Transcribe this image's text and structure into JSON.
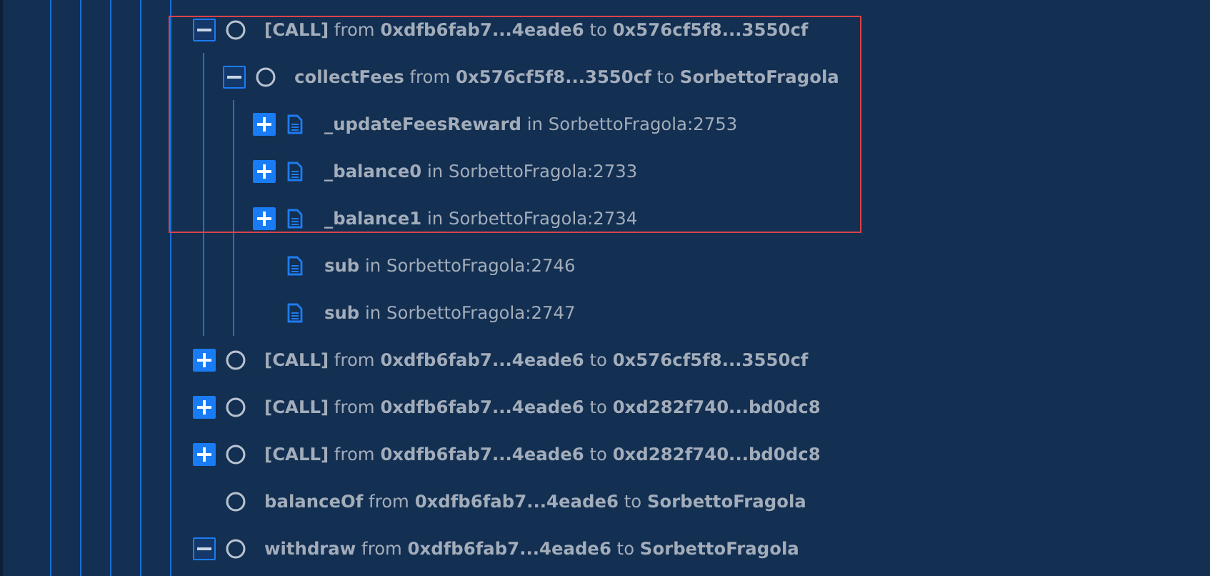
{
  "trace": [
    {
      "kind": "call",
      "expanded": true,
      "text": "**[CALL]** from **0xdfb6fab7...4eade6** to **0x576cf5f8...3550cf**",
      "children": [
        {
          "kind": "call",
          "expanded": true,
          "text": "**collectFees** from **0x576cf5f8...3550cf** to **SorbettoFragola**",
          "children": [
            {
              "kind": "function",
              "expanded": false,
              "text": "**_updateFeesReward** in SorbettoFragola:2753"
            },
            {
              "kind": "function",
              "expanded": false,
              "text": "**_balance0** in SorbettoFragola:2733"
            },
            {
              "kind": "function",
              "expanded": false,
              "text": "**_balance1** in SorbettoFragola:2734"
            },
            {
              "kind": "function",
              "text": "**sub** in SorbettoFragola:2746"
            },
            {
              "kind": "function",
              "text": "**sub** in SorbettoFragola:2747"
            }
          ]
        }
      ]
    },
    {
      "kind": "call",
      "expanded": false,
      "text": "**[CALL]** from **0xdfb6fab7...4eade6** to **0x576cf5f8...3550cf**"
    },
    {
      "kind": "call",
      "expanded": false,
      "text": "**[CALL]** from **0xdfb6fab7...4eade6** to **0xd282f740...bd0dc8**"
    },
    {
      "kind": "call",
      "expanded": false,
      "text": "**[CALL]** from **0xdfb6fab7...4eade6** to **0xd282f740...bd0dc8**"
    },
    {
      "kind": "call",
      "text": "**balanceOf** from **0xdfb6fab7...4eade6** to **SorbettoFragola**"
    },
    {
      "kind": "call",
      "expanded": true,
      "text": "**withdraw** from **0xdfb6fab7...4eade6** to **SorbettoFragola**"
    }
  ]
}
